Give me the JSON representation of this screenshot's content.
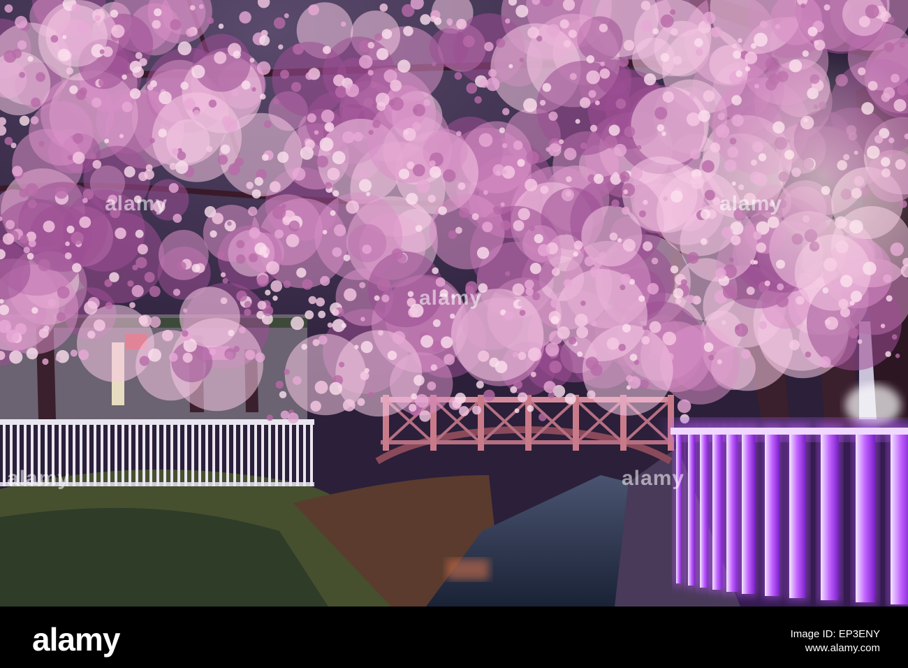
{
  "photo": {
    "description_colors": {
      "sky": "#3a2a52",
      "blossom_light": "#f6c9e4",
      "blossom_mid": "#d98fc6",
      "blossom_deep": "#9c4f93",
      "trunk": "#3a1f2c",
      "fence": "#e9e6ef",
      "neon": "#c060ff",
      "bridge": "#c97b8a",
      "hedge": "#5c6a3a",
      "water": "#1e2a40"
    }
  },
  "watermark": {
    "text": "alamy"
  },
  "footer": {
    "logo": "alamy",
    "image_id_line1": "Image ID: EP3ENY",
    "image_id_line2": "www.alamy.com"
  }
}
